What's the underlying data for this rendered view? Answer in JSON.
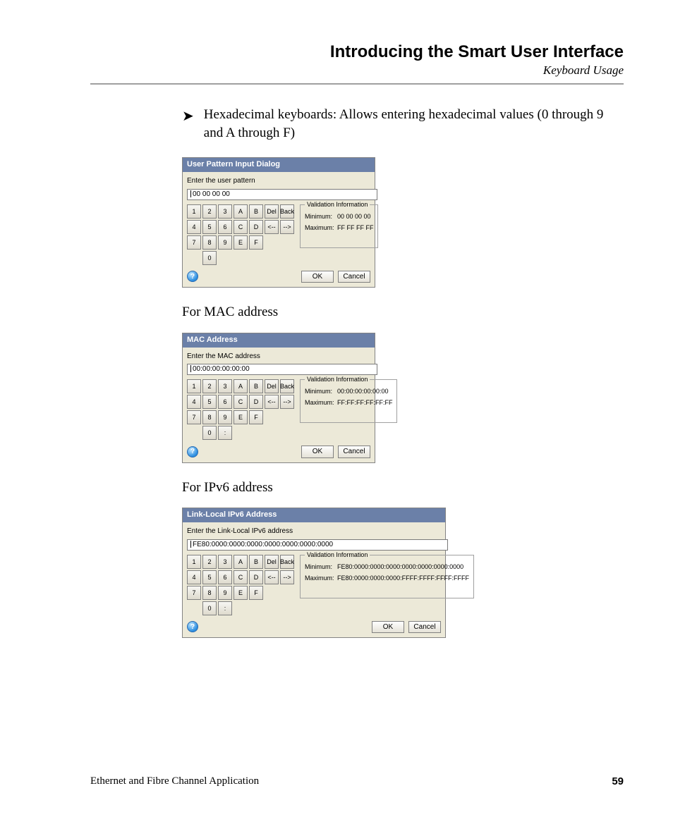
{
  "header": {
    "title": "Introducing the Smart User Interface",
    "subtitle": "Keyboard Usage"
  },
  "bullet": {
    "text": "Hexadecimal keyboards: Allows entering hexadecimal values (0 through 9 and A through F)"
  },
  "captions": {
    "mac": "For MAC address",
    "ipv6": "For IPv6 address"
  },
  "keys": {
    "r1": [
      "1",
      "2",
      "3",
      "A",
      "B",
      "Del",
      "Back"
    ],
    "r2": [
      "4",
      "5",
      "6",
      "C",
      "D",
      "<--",
      "-->"
    ],
    "r3": [
      "7",
      "8",
      "9",
      "E",
      "F"
    ],
    "zero": "0",
    "colon": ":"
  },
  "dialogs": {
    "pattern": {
      "title": "User Pattern Input Dialog",
      "prompt": "Enter the user pattern",
      "value": "00 00 00 00",
      "info_legend": "Validation Information",
      "min_label": "Minimum:",
      "min_value": "00 00 00 00",
      "max_label": "Maximum:",
      "max_value": "FF FF FF FF",
      "ok": "OK",
      "cancel": "Cancel"
    },
    "mac": {
      "title": "MAC Address",
      "prompt": "Enter the MAC address",
      "value": "00:00:00:00:00:00",
      "info_legend": "Validation Information",
      "min_label": "Minimum:",
      "min_value": "00:00:00:00:00:00",
      "max_label": "Maximum:",
      "max_value": "FF:FF:FF:FF:FF:FF",
      "ok": "OK",
      "cancel": "Cancel"
    },
    "ipv6": {
      "title": "Link-Local IPv6 Address",
      "prompt": "Enter the Link-Local IPv6 address",
      "value": "FE80:0000:0000:0000:0000:0000:0000:0000",
      "info_legend": "Validation Information",
      "min_label": "Minimum:",
      "min_value": "FE80:0000:0000:0000:0000:0000:0000:0000",
      "max_label": "Maximum:",
      "max_value": "FE80:0000:0000:0000:FFFF:FFFF:FFFF:FFFF",
      "ok": "OK",
      "cancel": "Cancel"
    }
  },
  "footer": {
    "left": "Ethernet and Fibre Channel Application",
    "page": "59"
  }
}
